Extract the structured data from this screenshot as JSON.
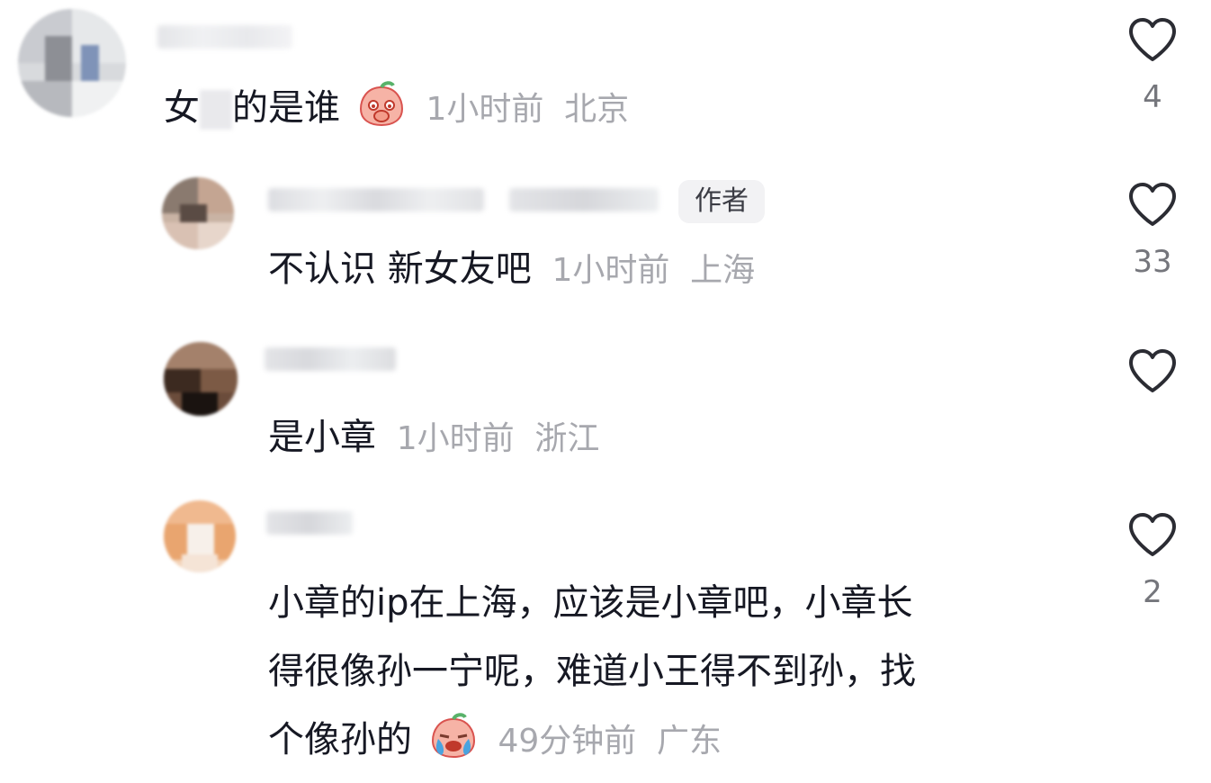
{
  "comments": [
    {
      "text_before_blur": "女",
      "text_blurred": " ",
      "text_after_blur": "的是谁",
      "emoji": "covering-mouth-peach-emoji",
      "time": "1小时前",
      "location": "北京",
      "likes": "4"
    },
    {
      "author_badge": "作者",
      "text": "不认识 新女友吧",
      "time": "1小时前",
      "location": "上海",
      "likes": "33"
    },
    {
      "text": "是小章",
      "time": "1小时前",
      "location": "浙江",
      "likes": ""
    },
    {
      "text_line1": "小章的ip在上海，应该是小章吧，小章长",
      "text_line2": "得很像孙一宁呢，难道小王得不到孙，找",
      "text_line3": "个像孙的",
      "emoji": "crying-peach-emoji",
      "time": "49分钟前",
      "location": "广东",
      "likes": "2"
    }
  ],
  "colors": {
    "text": "#161823",
    "meta": "#a7a8ae",
    "heart_stroke": "#2b2c33",
    "badge_bg": "#f2f2f4"
  },
  "icons": {
    "like": "heart-outline-icon"
  }
}
